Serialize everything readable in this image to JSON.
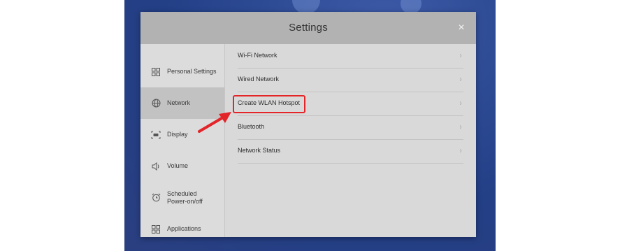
{
  "dialog": {
    "title": "Settings",
    "close_glyph": "×"
  },
  "sidebar": {
    "items": [
      {
        "label": "Personal Settings",
        "icon": "grid-icon",
        "active": false
      },
      {
        "label": "Network",
        "icon": "globe-icon",
        "active": true
      },
      {
        "label": "Display",
        "icon": "display-icon",
        "active": false
      },
      {
        "label": "Volume",
        "icon": "speaker-icon",
        "active": false
      },
      {
        "label": "Scheduled\nPower-on/off",
        "icon": "alarm-clock-icon",
        "active": false
      },
      {
        "label": "Applications",
        "icon": "grid-icon",
        "active": false
      }
    ]
  },
  "network": {
    "items": [
      {
        "label": "Wi-Fi Network"
      },
      {
        "label": "Wired Network"
      },
      {
        "label": "Create WLAN Hotspot",
        "highlighted": true
      },
      {
        "label": "Bluetooth"
      },
      {
        "label": "Network Status"
      }
    ],
    "chevron": "›"
  },
  "annotation": {
    "highlight_color": "#e32428"
  }
}
